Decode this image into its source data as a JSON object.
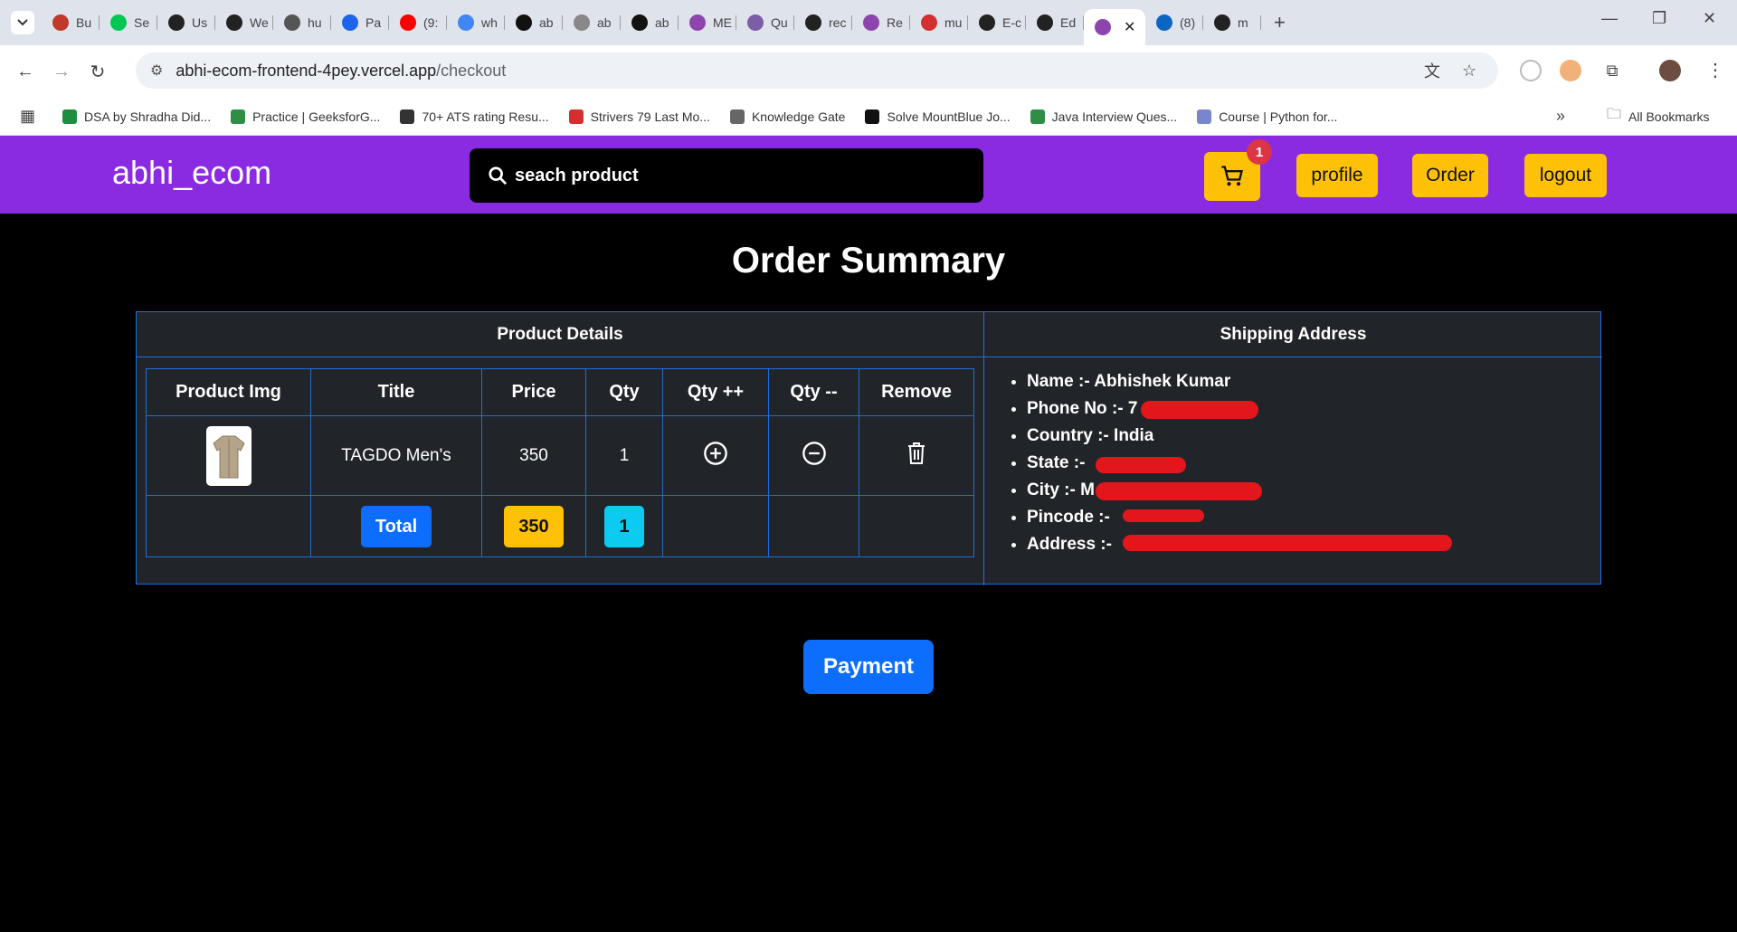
{
  "browser": {
    "tabs": [
      {
        "label": "Bu",
        "color": "#c0392b"
      },
      {
        "label": "Se",
        "color": "#00c853"
      },
      {
        "label": "Us",
        "color": "#222"
      },
      {
        "label": "We",
        "color": "#222"
      },
      {
        "label": "hu",
        "color": "#555"
      },
      {
        "label": "Pa",
        "color": "#1d63ed"
      },
      {
        "label": "(9:",
        "color": "#ff0000"
      },
      {
        "label": "wh",
        "color": "#4285f4"
      },
      {
        "label": "ab",
        "color": "#111"
      },
      {
        "label": "ab",
        "color": "#888"
      },
      {
        "label": "ab",
        "color": "#111"
      },
      {
        "label": "ME",
        "color": "#8e44ad"
      },
      {
        "label": "Qu",
        "color": "#7b5ea7"
      },
      {
        "label": "rec",
        "color": "#222"
      },
      {
        "label": "Re",
        "color": "#8e44ad"
      },
      {
        "label": "mu",
        "color": "#d32f2f"
      },
      {
        "label": "E-c",
        "color": "#222"
      },
      {
        "label": "Ed",
        "color": "#222"
      },
      {
        "label": "",
        "color": "#8e44ad",
        "active": true
      },
      {
        "label": "(8)",
        "color": "#0a66c2"
      },
      {
        "label": "m",
        "color": "#222"
      }
    ],
    "url_host": "abhi-ecom-frontend-4pey.vercel.app",
    "url_path": "/checkout",
    "bookmarks": [
      {
        "label": "DSA by Shradha Did...",
        "color": "#1e8e3e"
      },
      {
        "label": "Practice | GeeksforG...",
        "color": "#2f8d46"
      },
      {
        "label": "70+ ATS rating Resu...",
        "color": "#333"
      },
      {
        "label": "Strivers 79 Last Mo...",
        "color": "#d32f2f"
      },
      {
        "label": "Knowledge Gate",
        "color": "#666"
      },
      {
        "label": "Solve MountBlue Jo...",
        "color": "#111"
      },
      {
        "label": "Java Interview Ques...",
        "color": "#2f8d46"
      },
      {
        "label": "Course | Python for...",
        "color": "#7986cb"
      }
    ],
    "all_bookmarks": "All Bookmarks"
  },
  "navbar": {
    "brand": "abhi_ecom",
    "search_placeholder": "seach product",
    "cart_count": "1",
    "profile": "profile",
    "order": "Order",
    "logout": "logout",
    "bg_color": "#8a2be2",
    "button_color": "#ffc107"
  },
  "page": {
    "title": "Order Summary",
    "product_details_header": "Product Details",
    "shipping_header": "Shipping Address",
    "columns": [
      "Product Img",
      "Title",
      "Price",
      "Qty",
      "Qty ++",
      "Qty --",
      "Remove"
    ],
    "row": {
      "title": "TAGDO Men's",
      "price": "350",
      "qty": "1"
    },
    "totals": {
      "label": "Total",
      "price": "350",
      "qty": "1"
    },
    "shipping": {
      "name": "Name :- Abhishek Kumar",
      "phone": "Phone No :- 7",
      "country": "Country :- India",
      "state": "State :- ",
      "city": "City :- M",
      "pincode": "Pincode :- ",
      "address": "Address :- "
    },
    "payment": "Payment"
  }
}
